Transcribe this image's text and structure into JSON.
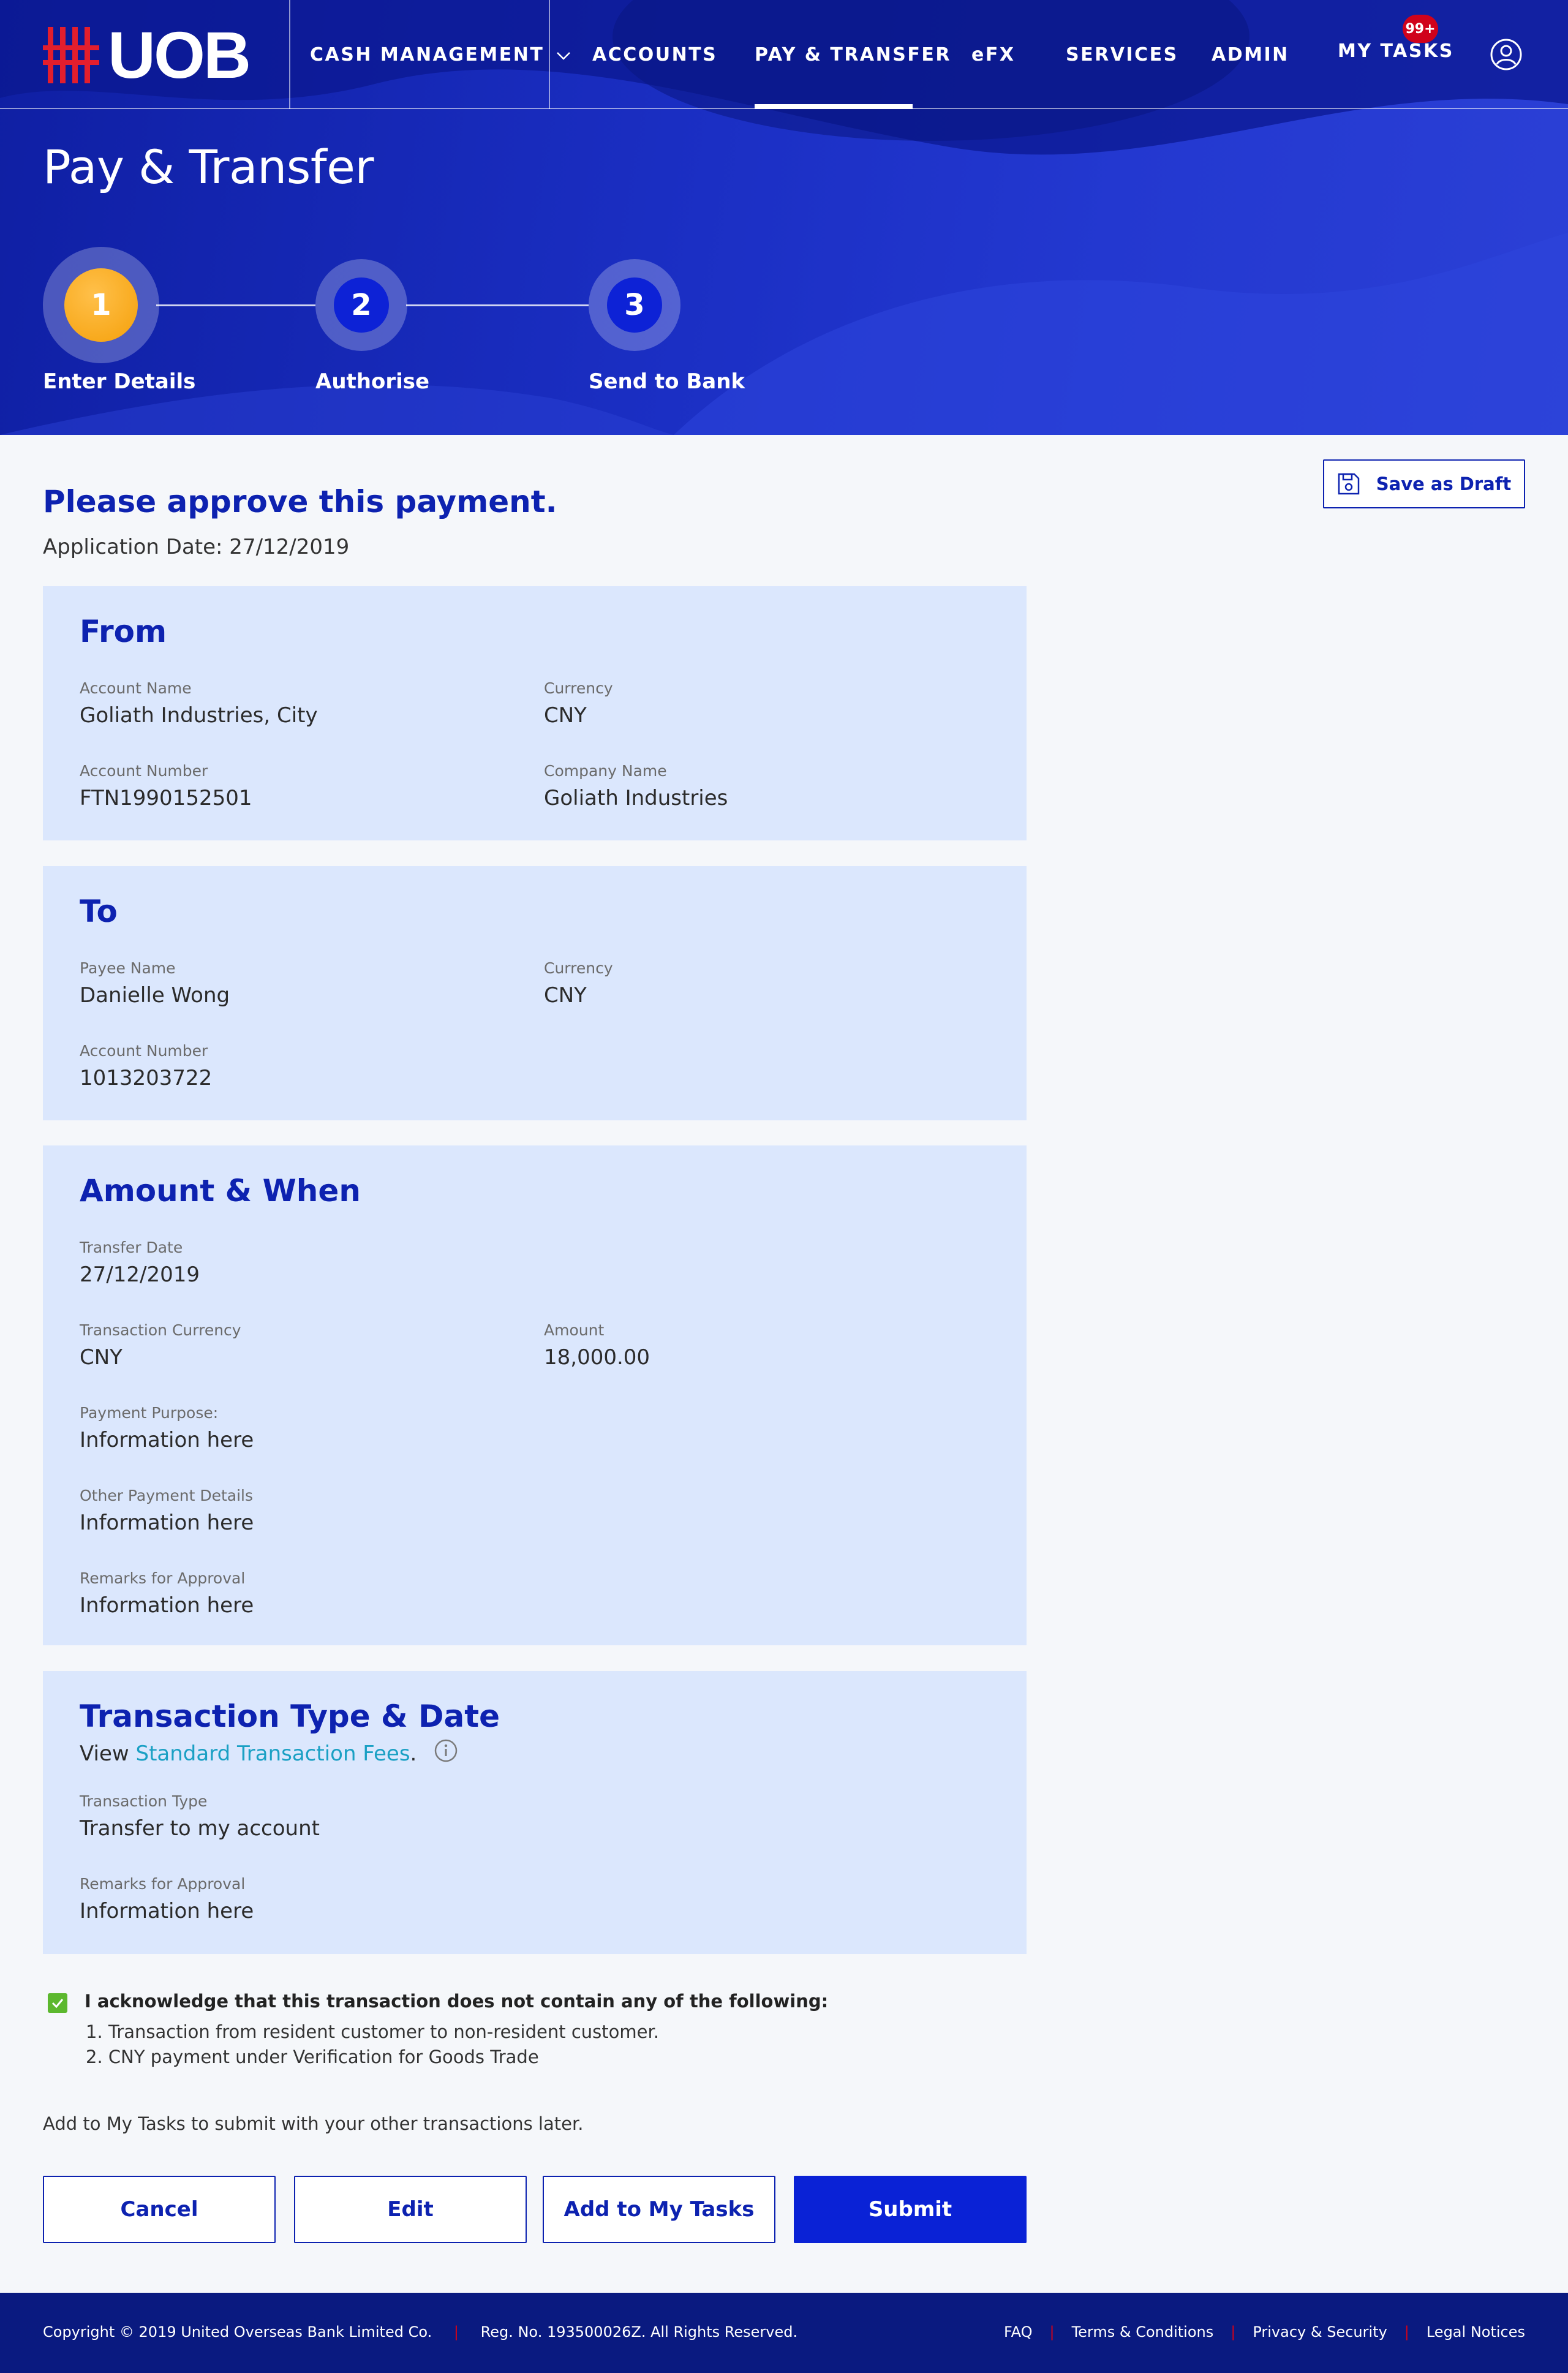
{
  "brand": {
    "name": "UOB",
    "accent": "#0d22b0",
    "logo_red": "#e31e2d"
  },
  "nav": {
    "items": [
      {
        "label": "CASH MANAGEMENT"
      },
      {
        "label": "ACCOUNTS"
      },
      {
        "label": "PAY & TRANSFER",
        "active": true
      },
      {
        "label": "eFX"
      },
      {
        "label": "SERVICES"
      },
      {
        "label": "ADMIN"
      },
      {
        "label": "MY TASKS"
      }
    ],
    "tasks_badge": "99+",
    "icons": [
      "chevron-down-icon",
      "user-profile-icon"
    ]
  },
  "page": {
    "title": "Pay & Transfer"
  },
  "stepper": {
    "steps": [
      {
        "number": "1",
        "label": "Enter Details",
        "state": "active"
      },
      {
        "number": "2",
        "label": "Authorise",
        "state": "pending"
      },
      {
        "number": "3",
        "label": "Send to Bank",
        "state": "pending"
      }
    ]
  },
  "actions": {
    "save_draft": "Save as Draft",
    "save_icon": "floppy-disk-icon"
  },
  "main": {
    "headline": "Please approve this payment.",
    "application_date": "Application Date: 27/12/2019"
  },
  "from": {
    "title": "From",
    "account_name_label": "Account Name",
    "account_name": "Goliath Industries, City",
    "currency_label": "Currency",
    "currency": "CNY",
    "account_number_label": "Account Number",
    "account_number": "FTN1990152501",
    "company_name_label": "Company Name",
    "company_name": "Goliath Industries"
  },
  "to": {
    "title": "To",
    "payee_name_label": "Payee Name",
    "payee_name": "Danielle Wong",
    "currency_label": "Currency",
    "currency": "CNY",
    "account_number_label": "Account Number",
    "account_number": "1013203722"
  },
  "amount": {
    "title": "Amount & When",
    "transfer_date_label": "Transfer Date",
    "transfer_date": "27/12/2019",
    "txn_currency_label": "Transaction Currency",
    "txn_currency": "CNY",
    "amount_label": "Amount",
    "amount": "18,000.00",
    "purpose_label": "Payment Purpose:",
    "purpose": "Information here",
    "other_label": "Other Payment Details",
    "other": "Information here",
    "remarks_label": "Remarks for Approval",
    "remarks": "Information here"
  },
  "txn_type": {
    "title": "Transaction Type & Date",
    "view_prefix": "View ",
    "fees_link": "Standard Transaction Fees",
    "view_suffix": ".",
    "info_icon": "info-icon",
    "type_label": "Transaction Type",
    "type": "Transfer to my account",
    "remarks_label": "Remarks for Approval",
    "remarks": "Information here"
  },
  "acknowledgement": {
    "checked": true,
    "title": "I acknowledge that this transaction does not contain any of the following:",
    "line1": "1. Transaction from resident customer to non-resident customer.",
    "line2": "2. CNY payment under Verification for Goods Trade"
  },
  "note": "Add to My Tasks to submit with your other transactions later.",
  "buttons": {
    "cancel": "Cancel",
    "edit": "Edit",
    "add_tasks": "Add to My Tasks",
    "submit": "Submit"
  },
  "footer": {
    "copyright": "Copyright © 2019 United Overseas Bank Limited Co.",
    "reg": "Reg. No. 193500026Z. All Rights Reserved.",
    "links": [
      "FAQ",
      "Terms & Conditions",
      "Privacy & Security",
      "Legal Notices"
    ]
  }
}
